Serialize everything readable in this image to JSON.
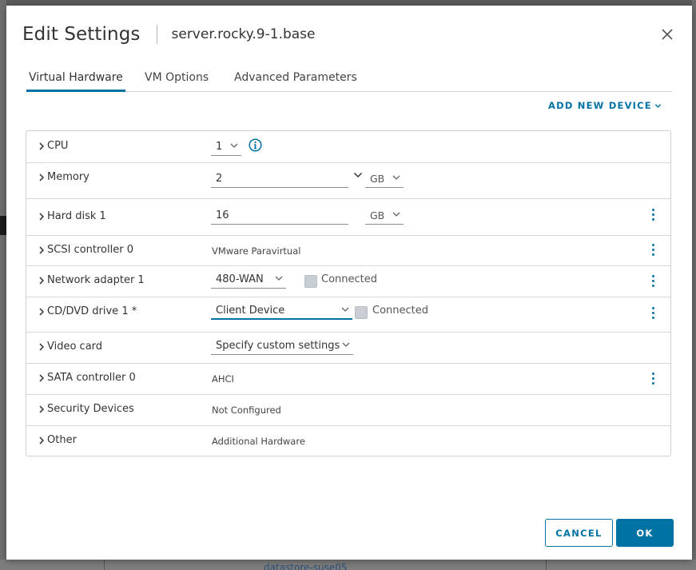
{
  "background": {
    "bottom_text": "datastore-suse05"
  },
  "dialog": {
    "title": "Edit Settings",
    "subtitle": "server.rocky.9-1.base"
  },
  "tabs": [
    {
      "label": "Virtual Hardware",
      "active": true
    },
    {
      "label": "VM Options",
      "active": false
    },
    {
      "label": "Advanced Parameters",
      "active": false
    }
  ],
  "add_device_label": "ADD NEW DEVICE",
  "hardware": {
    "cpu": {
      "label": "CPU",
      "value": "1"
    },
    "memory": {
      "label": "Memory",
      "value": "2",
      "unit": "GB"
    },
    "hard_disk": {
      "label": "Hard disk 1",
      "value": "16",
      "unit": "GB"
    },
    "scsi": {
      "label": "SCSI controller 0",
      "value": "VMware Paravirtual"
    },
    "network": {
      "label": "Network adapter 1",
      "value": "480-WAN",
      "connected_label": "Connected",
      "connected": false
    },
    "cdrom": {
      "label": "CD/DVD drive 1 *",
      "value": "Client Device",
      "connected_label": "Connected",
      "connected": false
    },
    "video": {
      "label": "Video card",
      "value": "Specify custom settings"
    },
    "sata": {
      "label": "SATA controller 0",
      "value": "AHCI"
    },
    "security": {
      "label": "Security Devices",
      "value": "Not Configured"
    },
    "other": {
      "label": "Other",
      "value": "Additional Hardware"
    }
  },
  "buttons": {
    "cancel": "CANCEL",
    "ok": "OK"
  },
  "colors": {
    "accent": "#0072a3",
    "border": "#cfcfcf",
    "checkbox_disabled": "#c8ced3"
  }
}
